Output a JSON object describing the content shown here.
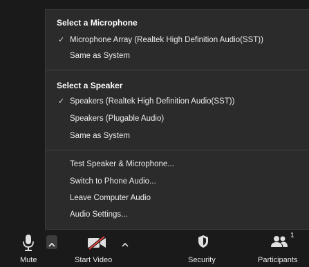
{
  "audio_menu": {
    "microphone": {
      "heading": "Select a Microphone",
      "items": [
        {
          "label": "Microphone Array (Realtek High Definition Audio(SST))",
          "checked": true
        },
        {
          "label": "Same as System",
          "checked": false
        }
      ]
    },
    "speaker": {
      "heading": "Select a Speaker",
      "items": [
        {
          "label": "Speakers (Realtek High Definition Audio(SST))",
          "checked": true
        },
        {
          "label": "Speakers (Plugable Audio)",
          "checked": false
        },
        {
          "label": "Same as System",
          "checked": false
        }
      ]
    },
    "actions": [
      {
        "label": "Test Speaker & Microphone..."
      },
      {
        "label": "Switch to Phone Audio..."
      },
      {
        "label": "Leave Computer Audio"
      },
      {
        "label": "Audio Settings..."
      }
    ],
    "check_glyph": "✓"
  },
  "toolbar": {
    "mute": {
      "label": "Mute",
      "icon": "microphone-icon"
    },
    "video": {
      "label": "Start Video",
      "icon": "video-off-icon"
    },
    "security": {
      "label": "Security",
      "icon": "shield-icon"
    },
    "participants": {
      "label": "Participants",
      "icon": "participants-icon",
      "count": "1"
    }
  },
  "colors": {
    "menu_bg": "#2b2b2b",
    "toolbar_bg": "#1a1a1a",
    "video_off_slash": "#e0403a",
    "text": "#ececec"
  }
}
